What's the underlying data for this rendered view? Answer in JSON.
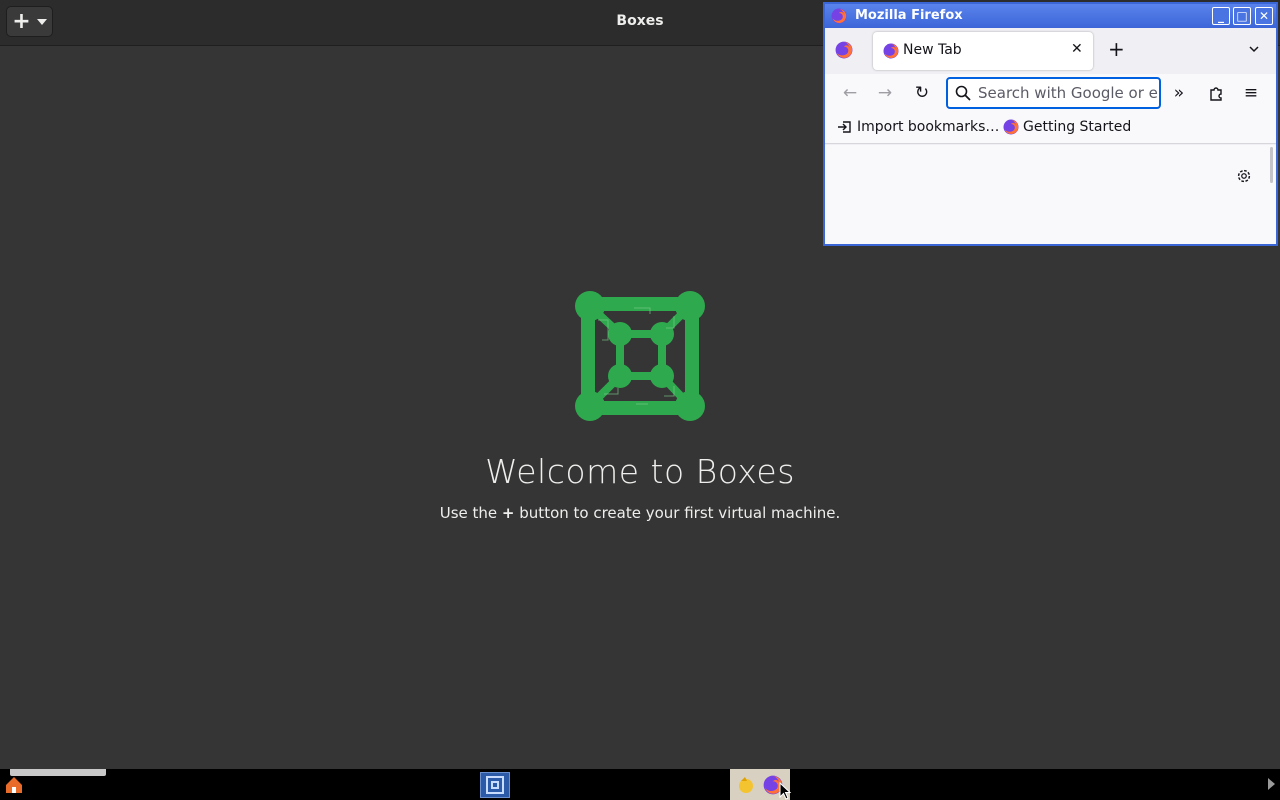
{
  "boxes": {
    "title": "Boxes",
    "add_button_label": "+",
    "welcome_title": "Welcome to Boxes",
    "welcome_sub_before": "Use the",
    "welcome_sub_plus": "+",
    "welcome_sub_after": "button to create your first virtual machine.",
    "logo_color": "#2fa94e"
  },
  "firefox": {
    "window_title": "Mozilla Firefox",
    "tab_label": "New Tab",
    "url_placeholder": "Search with Google or enter address",
    "bookmarks": [
      {
        "label": "Import bookmarks…",
        "icon": "import-icon"
      },
      {
        "label": "Getting Started",
        "icon": "firefox-icon"
      }
    ],
    "accent": "#0061e0",
    "titlebar_color": "#3c66d8"
  },
  "taskbar": {
    "items": [
      "home-icon",
      "boxes-app-icon",
      "launcher-icon",
      "firefox-icon"
    ]
  }
}
